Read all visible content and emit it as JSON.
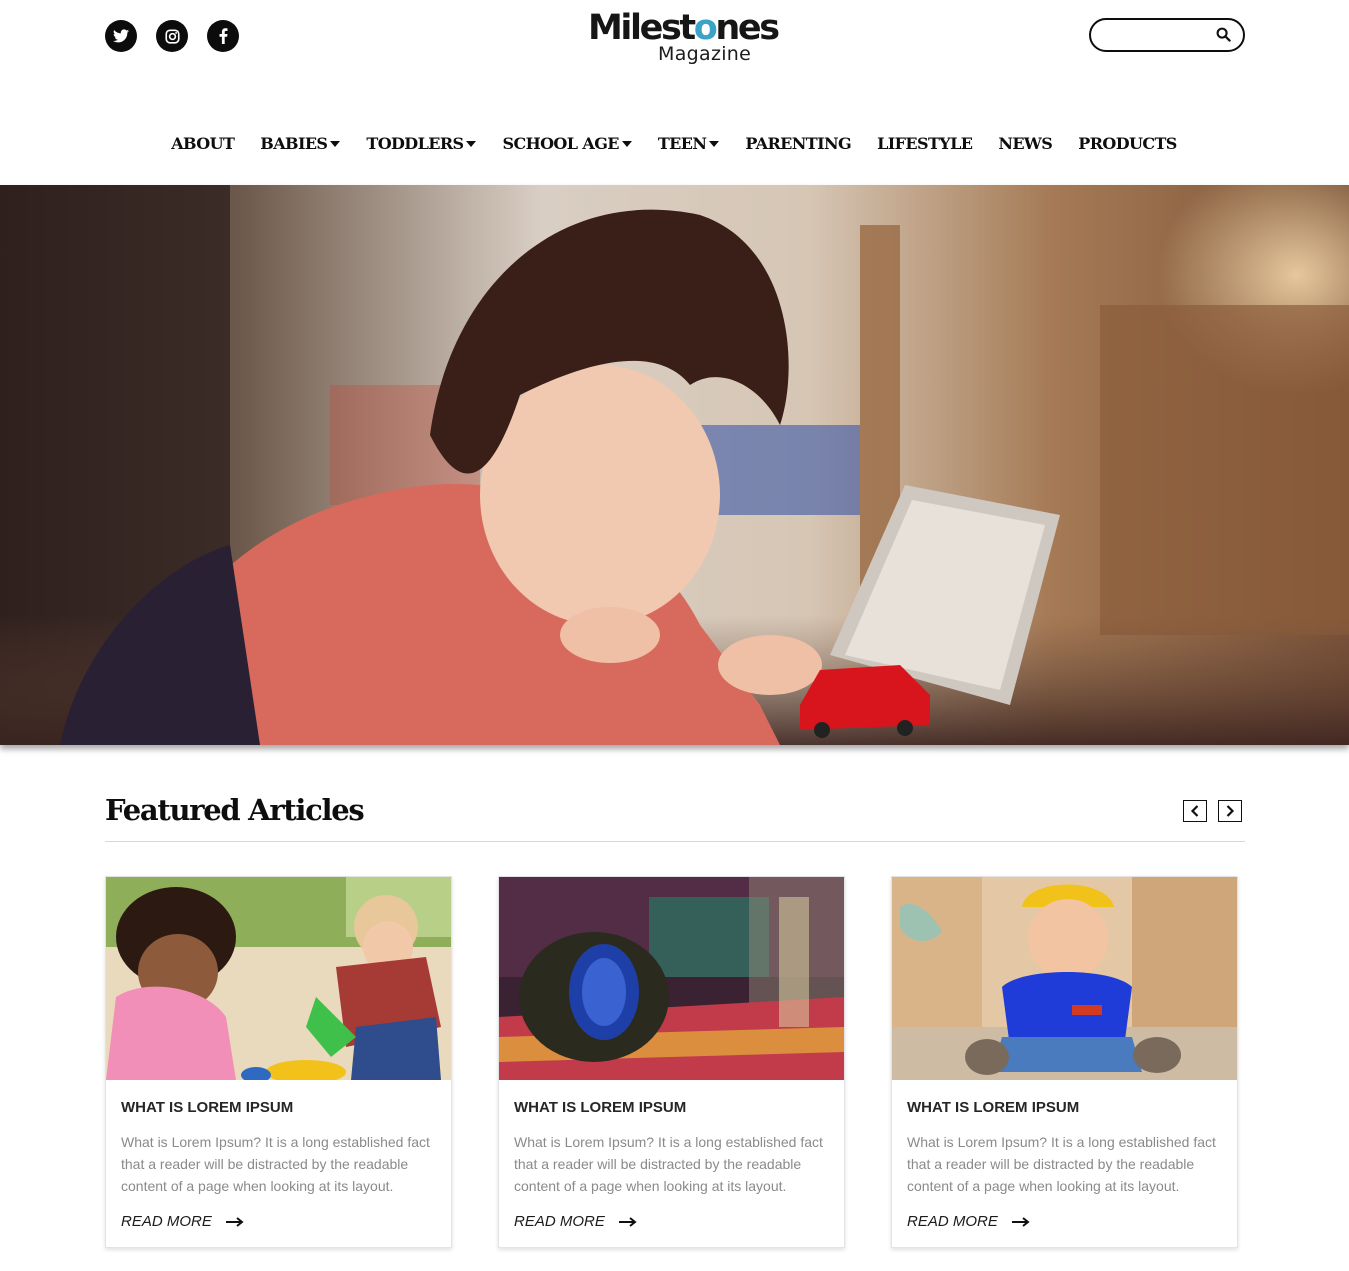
{
  "header": {
    "social": [
      {
        "name": "twitter-icon"
      },
      {
        "name": "instagram-icon"
      },
      {
        "name": "facebook-icon"
      }
    ],
    "logo": {
      "main_prefix": "Milest",
      "main_accent": "o",
      "main_suffix": "nes",
      "sub": "Magazine"
    },
    "search": {
      "placeholder": "",
      "value": ""
    }
  },
  "nav": {
    "items": [
      {
        "label": "ABOUT",
        "dropdown": false
      },
      {
        "label": "BABIES",
        "dropdown": true
      },
      {
        "label": "TODDLERS",
        "dropdown": true
      },
      {
        "label": "SCHOOL AGE",
        "dropdown": true
      },
      {
        "label": "TEEN",
        "dropdown": true
      },
      {
        "label": "PARENTING",
        "dropdown": false
      },
      {
        "label": "LIFESTYLE",
        "dropdown": false
      },
      {
        "label": "NEWS",
        "dropdown": false
      },
      {
        "label": "PRODUCTS",
        "dropdown": false
      }
    ]
  },
  "featured": {
    "title": "Featured Articles",
    "prev_icon": "chevron-left-icon",
    "next_icon": "chevron-right-icon",
    "cards": [
      {
        "title": "WHAT IS LOREM IPSUM",
        "excerpt": "What is Lorem Ipsum? It is a long established fact that a reader will be distracted by the readable content of a page when looking at its layout.",
        "read_more": "READ MORE"
      },
      {
        "title": "WHAT IS LOREM IPSUM",
        "excerpt": "What is Lorem Ipsum? It is a long established fact that a reader will be distracted by the readable content of a page when looking at its layout.",
        "read_more": "READ MORE"
      },
      {
        "title": "WHAT IS LOREM IPSUM",
        "excerpt": "What is Lorem Ipsum? It is a long established fact that a reader will be distracted by the readable content of a page when looking at its layout.",
        "read_more": "READ MORE"
      }
    ]
  },
  "colors": {
    "text": "#0e0e0e",
    "muted": "#8a8a8a",
    "logo_accent": "#3aa3c7",
    "divider": "#d8d8d8"
  }
}
